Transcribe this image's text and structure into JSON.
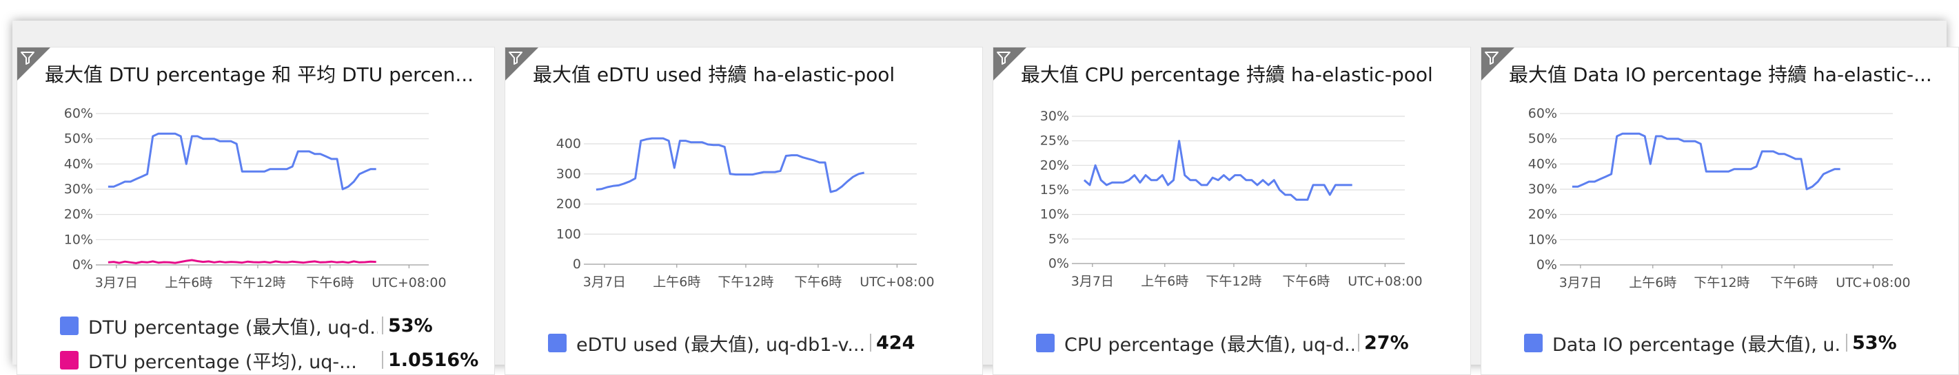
{
  "colors": {
    "blue": "#5c7ff0",
    "magenta": "#e60d8a",
    "grid": "#dddddd",
    "axis": "#9e9e9e"
  },
  "icons": {
    "tile_corner": "filter-icon"
  },
  "tiles": [
    {
      "title": "最大值 DTU percentage 和 平均 DTU percen...",
      "legend": [
        {
          "label": "DTU percentage (最大值), uq-d...",
          "value": "53%",
          "color": "#5c7ff0"
        },
        {
          "label": "DTU percentage (平均), uq-...",
          "value": "1.0516%",
          "color": "#e60d8a"
        }
      ]
    },
    {
      "title": "最大值 eDTU used 持續 ha-elastic-pool",
      "legend": [
        {
          "label": "eDTU used (最大值), uq-db1-v...",
          "value": "424",
          "color": "#5c7ff0"
        }
      ]
    },
    {
      "title": "最大值 CPU percentage 持續 ha-elastic-pool",
      "legend": [
        {
          "label": "CPU percentage (最大值), uq-d...",
          "value": "27%",
          "color": "#5c7ff0"
        }
      ]
    },
    {
      "title": "最大值 Data IO percentage 持續 ha-elastic-...",
      "legend": [
        {
          "label": "Data IO percentage (最大值), u...",
          "value": "53%",
          "color": "#5c7ff0"
        }
      ]
    }
  ],
  "chart_data": [
    {
      "type": "line",
      "x_ticks": [
        "3月7日",
        "上午6時",
        "下午12時",
        "下午6時",
        "UTC+08:00"
      ],
      "y_ticks": [
        "0%",
        "10%",
        "20%",
        "30%",
        "40%",
        "50%",
        "60%"
      ],
      "ylim": [
        0,
        60
      ],
      "grid": true,
      "series": [
        {
          "name": "DTU percentage (最大值), uq-d...",
          "color": "#5c7ff0",
          "values": [
            31,
            31,
            32,
            33,
            33,
            34,
            35,
            36,
            51,
            52,
            52,
            52,
            52,
            51,
            40,
            51,
            51,
            50,
            50,
            50,
            49,
            49,
            49,
            48,
            37,
            37,
            37,
            37,
            37,
            38,
            38,
            38,
            38,
            39,
            45,
            45,
            45,
            44,
            44,
            43,
            42,
            42,
            30,
            31,
            33,
            36,
            37,
            38,
            38
          ]
        },
        {
          "name": "DTU percentage (平均), uq-...",
          "color": "#e60d8a",
          "values": [
            1,
            1.2,
            0.8,
            1.3,
            1,
            0.7,
            1.2,
            1,
            1.4,
            0.9,
            1.1,
            1,
            0.8,
            1.2,
            1.6,
            1.9,
            1.5,
            1.2,
            1.4,
            1,
            1.3,
            1,
            1.2,
            1.1,
            0.9,
            1.3,
            1.1,
            1,
            1.2,
            0.9,
            1.4,
            1.1,
            1,
            1.3,
            1.1,
            0.9,
            1.2,
            1.4,
            1,
            1.1,
            1.3,
            1,
            1.2,
            0.9,
            1.4,
            1,
            1.1,
            1.3,
            1.2
          ]
        }
      ]
    },
    {
      "type": "line",
      "x_ticks": [
        "3月7日",
        "上午6時",
        "下午12時",
        "下午6時",
        "UTC+08:00"
      ],
      "y_ticks": [
        "0",
        "100",
        "200",
        "300",
        "400"
      ],
      "ylim": [
        0,
        480
      ],
      "grid": true,
      "series": [
        {
          "name": "eDTU used (最大值), uq-db1-v...",
          "color": "#5c7ff0",
          "values": [
            248,
            250,
            256,
            260,
            262,
            268,
            275,
            285,
            410,
            415,
            418,
            418,
            418,
            410,
            320,
            410,
            410,
            405,
            405,
            405,
            398,
            396,
            396,
            390,
            300,
            298,
            298,
            298,
            298,
            302,
            306,
            306,
            306,
            310,
            360,
            362,
            362,
            355,
            350,
            345,
            338,
            338,
            240,
            245,
            258,
            275,
            290,
            300,
            304
          ]
        }
      ]
    },
    {
      "type": "line",
      "x_ticks": [
        "3月7日",
        "上午6時",
        "下午12時",
        "下午6時",
        "UTC+08:00"
      ],
      "y_ticks": [
        "0%",
        "5%",
        "10%",
        "15%",
        "20%",
        "25%",
        "30%"
      ],
      "ylim": [
        0,
        30
      ],
      "grid": true,
      "series": [
        {
          "name": "CPU percentage (最大值), uq-d...",
          "color": "#5c7ff0",
          "values": [
            17,
            16,
            20,
            17,
            16,
            16.5,
            16.5,
            16.5,
            17,
            18,
            16.5,
            18,
            17,
            17,
            18,
            16,
            17,
            25,
            18,
            17,
            17,
            16,
            16,
            17.5,
            17,
            18,
            17,
            18,
            18,
            17,
            17,
            16,
            17,
            16,
            17,
            15,
            14,
            14,
            13,
            13,
            13,
            16,
            16,
            16,
            14,
            16,
            16,
            16,
            16
          ]
        }
      ]
    },
    {
      "type": "line",
      "x_ticks": [
        "3月7日",
        "上午6時",
        "下午12時",
        "下午6時",
        "UTC+08:00"
      ],
      "y_ticks": [
        "0%",
        "10%",
        "20%",
        "30%",
        "40%",
        "50%",
        "60%"
      ],
      "ylim": [
        0,
        60
      ],
      "grid": true,
      "series": [
        {
          "name": "Data IO percentage (最大值), u...",
          "color": "#5c7ff0",
          "values": [
            31,
            31,
            32,
            33,
            33,
            34,
            35,
            36,
            51,
            52,
            52,
            52,
            52,
            51,
            40,
            51,
            51,
            50,
            50,
            50,
            49,
            49,
            49,
            48,
            37,
            37,
            37,
            37,
            37,
            38,
            38,
            38,
            38,
            39,
            45,
            45,
            45,
            44,
            44,
            43,
            42,
            42,
            30,
            31,
            33,
            36,
            37,
            38,
            38
          ]
        }
      ]
    }
  ]
}
